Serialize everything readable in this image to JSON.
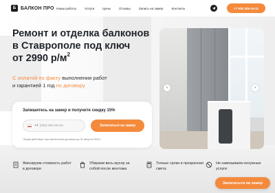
{
  "header": {
    "logo_mark": "Б",
    "logo_text": "БАЛКОН ПРО",
    "nav": [
      "Наши работы",
      "Услуги",
      "Цены",
      "Отзывы",
      "Запись на замер",
      "Контакты"
    ],
    "telegram_icon": "telegram-icon",
    "phone": "+7 938 309-15-11"
  },
  "hero": {
    "title_line1": "Ремонт и отделка балконов",
    "title_line2": "в Ставрополе под ключ",
    "title_line3": "от 2990 р/м",
    "title_sup": "2",
    "sub_accent1": "С оплатой по факту",
    "sub_text1": " выполнения работ",
    "sub_text2": "и гарантией 1 год ",
    "sub_accent2": "по договору"
  },
  "form": {
    "title": "Запишитесь на замер и получите скидку 15%",
    "phone_code": "+7",
    "phone_placeholder": "(000) 000-00-00",
    "submit_label": "Записаться на замер",
    "note": "*Акция действует при заключении договора до 31 августа 2026 г."
  },
  "features": [
    {
      "icon": "document-icon",
      "text": "Фиксируем стоимость работ в договоре"
    },
    {
      "icon": "trash-icon",
      "text": "Убираем весь мусор за собой после монтажа"
    },
    {
      "icon": "calculator-icon",
      "text": "Точные сроки и прозрачная смета"
    },
    {
      "icon": "no-upsell-icon",
      "text": "Не навязываем ненужные услуги"
    }
  ],
  "cta": {
    "label": "Записаться на замер"
  },
  "colors": {
    "accent": "#f48a3c",
    "dark": "#1f2329"
  }
}
